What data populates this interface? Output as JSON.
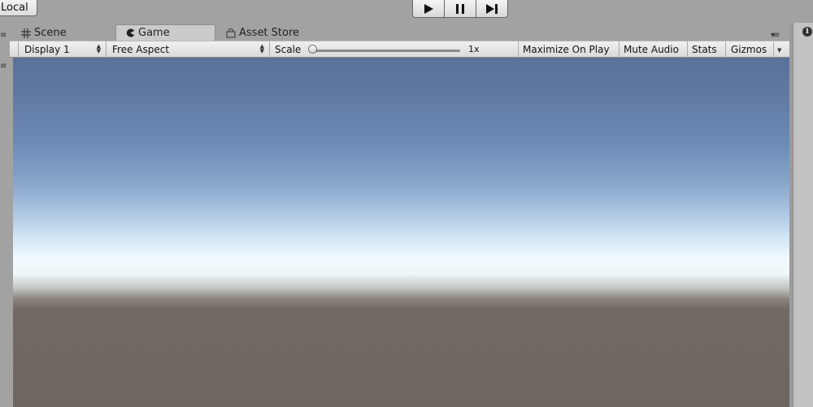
{
  "toolbar": {
    "local_label": "Local",
    "play_icon": "play-icon",
    "pause_icon": "pause-icon",
    "step_icon": "step-icon"
  },
  "tabs": [
    {
      "label": "Scene",
      "icon": "grid-icon"
    },
    {
      "label": "Game",
      "icon": "pacman-icon"
    },
    {
      "label": "Asset Store",
      "icon": "bag-icon"
    }
  ],
  "game_toolbar": {
    "display": "Display 1",
    "aspect": "Free Aspect",
    "scale_label": "Scale",
    "scale_value": "1x",
    "maximize": "Maximize On Play",
    "mute": "Mute Audio",
    "stats": "Stats",
    "gizmos": "Gizmos"
  },
  "right_panel": {
    "info_glyph": "i"
  },
  "colors": {
    "sky_top": "#5a7199",
    "horizon": "#f3fbff",
    "ground": "#6d6560"
  }
}
